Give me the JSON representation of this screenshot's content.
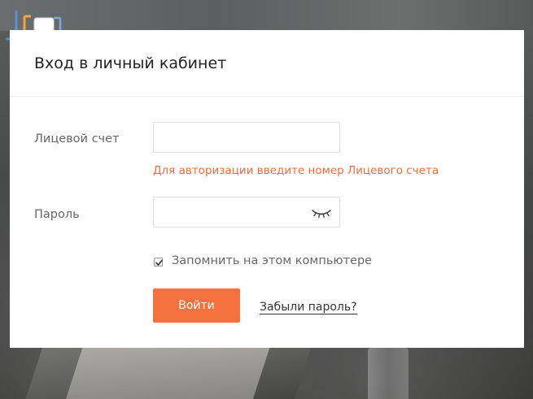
{
  "page": {
    "title": "Вход в личный кабинет"
  },
  "form": {
    "account": {
      "label": "Лицевой счет",
      "value": "",
      "placeholder": "",
      "hint": "Для авторизации введите номер Лицевого счета"
    },
    "password": {
      "label": "Пароль",
      "value": "",
      "placeholder": "",
      "toggle_icon": "eye-closed-icon"
    },
    "remember": {
      "label": "Запомнить на этом компьютере",
      "checked": true
    },
    "submit_label": "Войти",
    "forgot_label": "Забыли пароль?"
  },
  "colors": {
    "accent": "#f5713e",
    "hint": "#f26b3a",
    "logo_left": "#5b8fd6",
    "logo_right": "#f2a53a"
  }
}
